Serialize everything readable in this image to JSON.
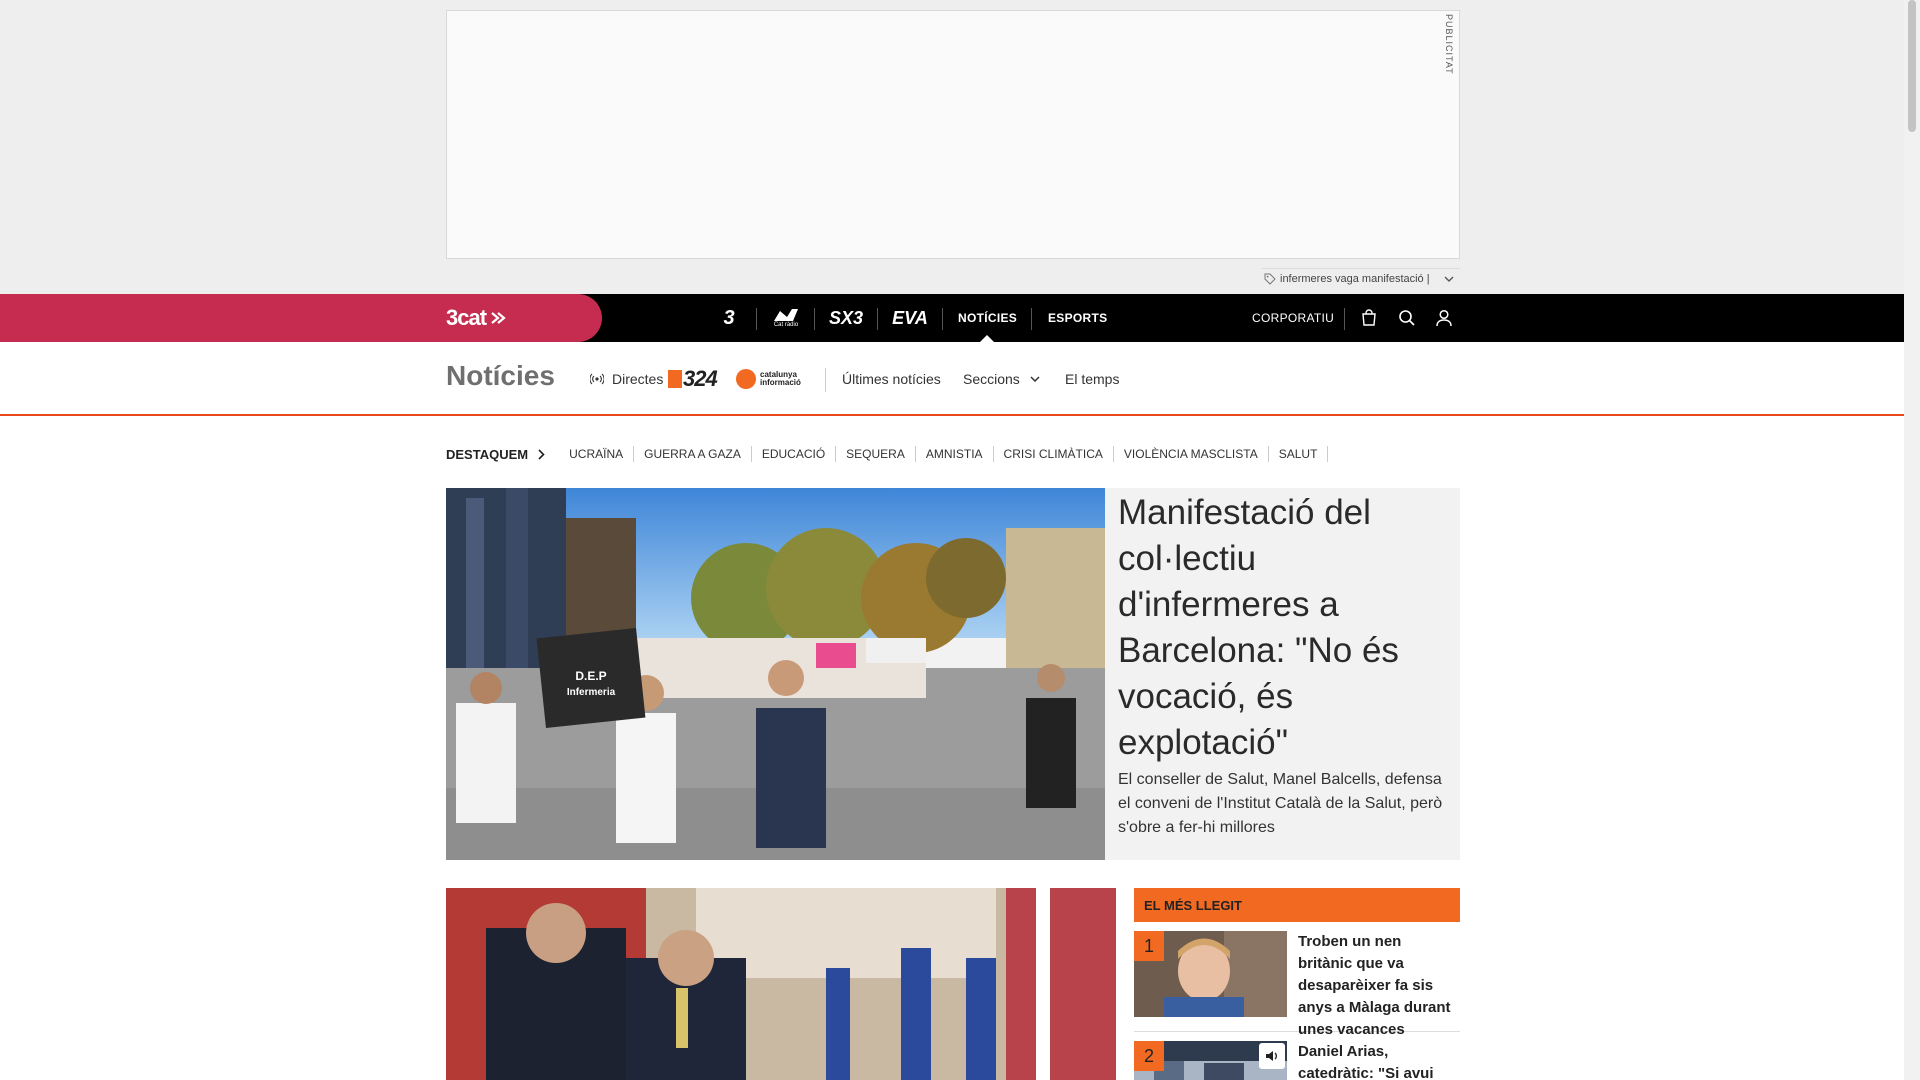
{
  "ad": {
    "label": "PUBLICITAT",
    "trending_text": "infermeres vaga manifestació |"
  },
  "topnav": {
    "brand": "3cat",
    "channels": [
      "3",
      "CatRàdio",
      "SX3",
      "EVA"
    ],
    "catradio_caption": "Cat ràdio",
    "items": [
      "NOTÍCIES",
      "ESPORTS"
    ],
    "corporate": "CORPORATIU",
    "icons": [
      "shopping-bag-icon",
      "search-icon",
      "user-icon"
    ]
  },
  "secnav": {
    "title": "Notícies",
    "live_label": "Directes",
    "channel_logo_324": "324",
    "channel_logo_ci_line1": "catalunya",
    "channel_logo_ci_line2": "informació",
    "items": [
      "Últimes notícies",
      "Seccions",
      "El temps"
    ]
  },
  "tags": {
    "heading": "DESTAQUEM",
    "items": [
      "UCRAÏNA",
      "GUERRA A GAZA",
      "EDUCACIÓ",
      "SEQUERA",
      "AMNISTIA",
      "CRISI CLIMÀTICA",
      "VIOLÈNCIA MASCLISTA",
      "SALUT"
    ]
  },
  "hero": {
    "title": "Manifestació del col·lectiu d'infermeres a Barcelona: \"No és vocació, és explotació\"",
    "summary": "El conseller de Salut, Manel Balcells, defensa el conveni de l'Institut Català de la Salut, però s'obre a fer-hi millores",
    "photo_signs": [
      "D.E.P",
      "Infermeria"
    ]
  },
  "most_read": {
    "heading": "EL MÉS LLEGIT",
    "items": [
      {
        "rank": "1",
        "title": "Troben un nen britànic que va desaparèixer fa sis anys a Màlaga durant unes vacances"
      },
      {
        "rank": "2",
        "title": "Daniel Arias, catedràtic: \"Si avui"
      }
    ]
  },
  "colors": {
    "brand": "#c62c4f",
    "accent_orange": "#f26a21",
    "nav_bg": "#000000",
    "section_rule": "#e8471a"
  }
}
